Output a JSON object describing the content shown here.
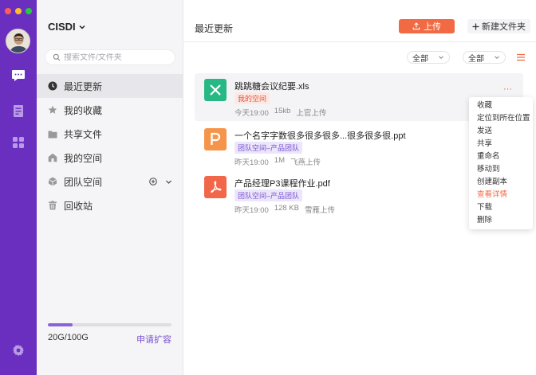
{
  "workspace": {
    "name": "CISDI"
  },
  "search": {
    "placeholder": "搜索文件/文件夹"
  },
  "nav": [
    {
      "label": "最近更新",
      "icon": "clock-icon",
      "active": true
    },
    {
      "label": "我的收藏",
      "icon": "star-icon"
    },
    {
      "label": "共享文件",
      "icon": "folder-icon"
    },
    {
      "label": "我的空间",
      "icon": "home-icon"
    },
    {
      "label": "团队空间",
      "icon": "team-cube-icon"
    },
    {
      "label": "回收站",
      "icon": "trash-icon"
    }
  ],
  "storage": {
    "usage": "20G/100G",
    "used_fraction": 0.2,
    "expand_label": "申请扩容"
  },
  "main": {
    "title": "最近更新",
    "upload_label": "上传",
    "new_folder_label": "新建文件夹",
    "filter1": "全部",
    "filter2": "全部"
  },
  "files": [
    {
      "name": "跳跳糖会议纪要.xls",
      "tag": "我的空间",
      "time": "今天19:00",
      "size": "15kb",
      "uploader": "上官上传",
      "type": "excel",
      "color": "#27b884",
      "more": "···"
    },
    {
      "name": "一个名字字数很多很多很多...很多很多很.ppt",
      "tag": "团队空间–产品团队",
      "time": "昨天19:00",
      "size": "1M",
      "uploader": "飞燕上传",
      "type": "ppt",
      "color": "#f6944a"
    },
    {
      "name": "产品经理P3课程作业.pdf",
      "tag": "团队空间–产品团队",
      "time": "昨天19:00",
      "size": "128 KB",
      "uploader": "雪雁上传",
      "type": "pdf",
      "color": "#f2664a"
    }
  ],
  "context_menu": [
    "收藏",
    "定位到所在位置",
    "发送",
    "共享",
    "重命名",
    "移动到",
    "创建副本",
    "查看详情",
    "下载",
    "删除"
  ],
  "colors": {
    "rail": "#6b2fc0",
    "accent": "#f26a43",
    "purple": "#7a52d0"
  }
}
